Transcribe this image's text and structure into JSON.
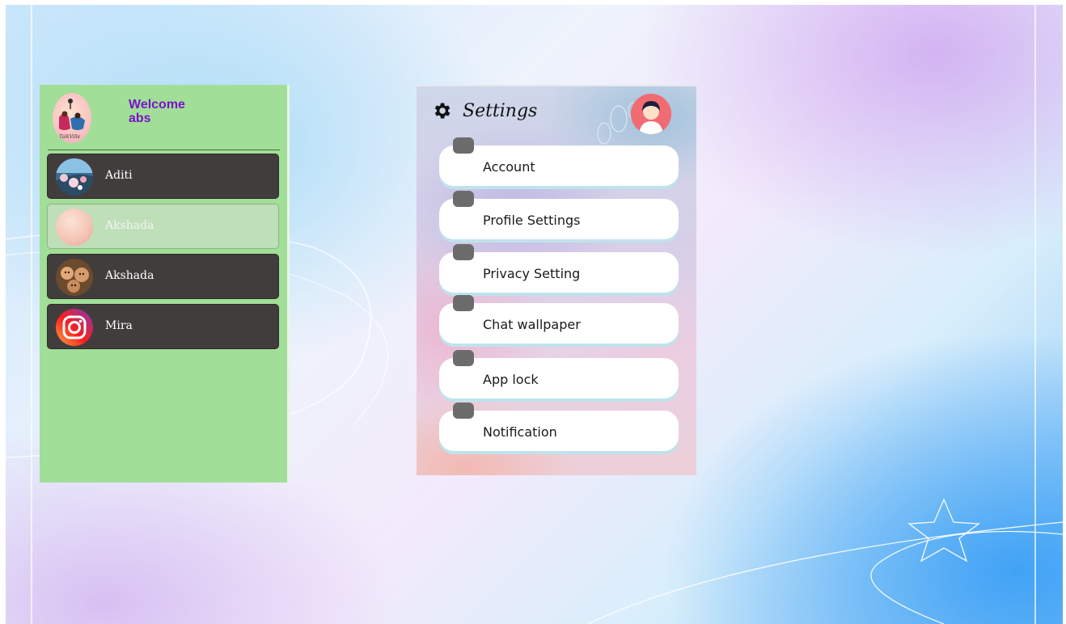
{
  "chat_list": {
    "welcome_line1": "Welcome",
    "welcome_line2": "abs",
    "logo_text": "TalkVille",
    "contacts": [
      {
        "name": "Aditi",
        "avatar": "blossom-photo-icon",
        "active": false
      },
      {
        "name": "Akshada",
        "avatar": "peach-gradient-icon",
        "active": true
      },
      {
        "name": "Akshada",
        "avatar": "kids-photo-icon",
        "active": false
      },
      {
        "name": "Mira",
        "avatar": "instagram-icon",
        "active": false
      }
    ]
  },
  "settings": {
    "title": "Settings",
    "items": [
      {
        "label": "Account"
      },
      {
        "label": "Profile Settings"
      },
      {
        "label": "Privacy Setting"
      },
      {
        "label": "Chat wallpaper"
      },
      {
        "label": "App lock"
      },
      {
        "label": "Notification"
      }
    ]
  },
  "colors": {
    "chat_panel_bg": "#a1de98",
    "contact_bg": "#423d3d",
    "contact_active_bg": "#bfdfb8",
    "welcome_text": "#7b12c9",
    "settings_item_bg": "#ffffff",
    "settings_icon_box": "#6c6c6c"
  }
}
